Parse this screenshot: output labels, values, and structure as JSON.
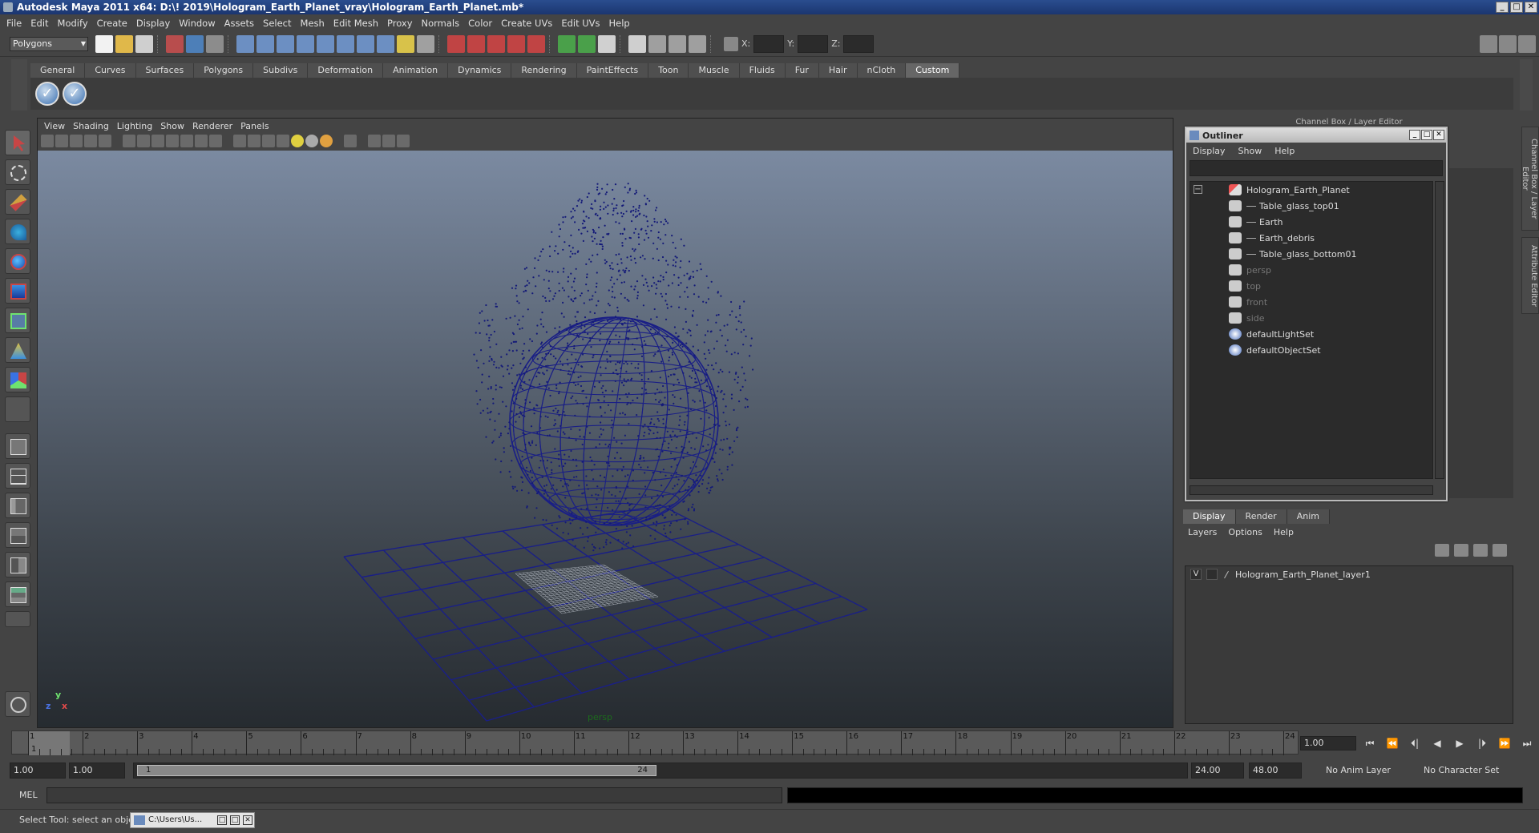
{
  "window": {
    "title": "Autodesk Maya 2011 x64: D:\\! 2019\\Hologram_Earth_Planet_vray\\Hologram_Earth_Planet.mb*",
    "min": "_",
    "max": "□",
    "close": "✕"
  },
  "menubar": [
    "File",
    "Edit",
    "Modify",
    "Create",
    "Display",
    "Window",
    "Assets",
    "Select",
    "Mesh",
    "Edit Mesh",
    "Proxy",
    "Normals",
    "Color",
    "Create UVs",
    "Edit UVs",
    "Help"
  ],
  "statusline": {
    "mode": "Polygons",
    "x_label": "X:",
    "y_label": "Y:",
    "z_label": "Z:"
  },
  "shelf": {
    "tabs": [
      "General",
      "Curves",
      "Surfaces",
      "Polygons",
      "Subdivs",
      "Deformation",
      "Animation",
      "Dynamics",
      "Rendering",
      "PaintEffects",
      "Toon",
      "Muscle",
      "Fluids",
      "Fur",
      "Hair",
      "nCloth",
      "Custom"
    ],
    "active_tab": "Custom"
  },
  "viewport": {
    "menu": [
      "View",
      "Shading",
      "Lighting",
      "Show",
      "Renderer",
      "Panels"
    ],
    "camera": "persp",
    "axis": {
      "x": "x",
      "y": "y",
      "z": "z"
    },
    "wire_color": "#1a1f86"
  },
  "dock": {
    "channel_header": "Channel Box / Layer Editor",
    "side_tabs": [
      "Channel Box / Layer Editor",
      "Attribute Editor"
    ]
  },
  "outliner": {
    "title": "Outliner",
    "menu": [
      "Display",
      "Show",
      "Help"
    ],
    "items": [
      {
        "label": "Hologram_Earth_Planet",
        "level": 0,
        "expand": "−",
        "dim": false
      },
      {
        "label": "Table_glass_top01",
        "level": 1,
        "dim": false
      },
      {
        "label": "Earth",
        "level": 1,
        "dim": false
      },
      {
        "label": "Earth_debris",
        "level": 1,
        "dim": false
      },
      {
        "label": "Table_glass_bottom01",
        "level": 1,
        "dim": false
      },
      {
        "label": "persp",
        "level": 0,
        "dim": true
      },
      {
        "label": "top",
        "level": 0,
        "dim": true
      },
      {
        "label": "front",
        "level": 0,
        "dim": true
      },
      {
        "label": "side",
        "level": 0,
        "dim": true
      },
      {
        "label": "defaultLightSet",
        "level": 0,
        "dim": false
      },
      {
        "label": "defaultObjectSet",
        "level": 0,
        "dim": false
      }
    ]
  },
  "layers": {
    "tabs": [
      "Display",
      "Render",
      "Anim"
    ],
    "active_tab": "Display",
    "menu": [
      "Layers",
      "Options",
      "Help"
    ],
    "rows": [
      {
        "visible": "V",
        "name": "Hologram_Earth_Planet_layer1"
      }
    ]
  },
  "timeline": {
    "ticks": [
      "1",
      "2",
      "3",
      "4",
      "5",
      "6",
      "7",
      "8",
      "9",
      "10",
      "11",
      "12",
      "13",
      "14",
      "15",
      "16",
      "17",
      "18",
      "19",
      "20",
      "21",
      "22",
      "23",
      "24"
    ],
    "current_frame": "1",
    "current_time": "1.00",
    "play_buttons": [
      "⏮",
      "⏪",
      "⏴|",
      "◀",
      "▶",
      "|⏵",
      "⏩",
      "⏭"
    ]
  },
  "range": {
    "start_time": "1.00",
    "playback_start": "1.00",
    "range_start": "1",
    "range_end": "24",
    "playback_end": "24.00",
    "end_time": "48.00",
    "anim_layer": "No Anim Layer",
    "character_set": "No Character Set"
  },
  "command": {
    "lang": "MEL"
  },
  "help": {
    "text": "Select Tool: select an object",
    "task_label": "C:\\Users\\Us..."
  }
}
